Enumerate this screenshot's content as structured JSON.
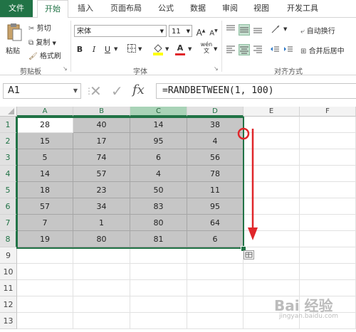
{
  "ribbon_tabs": [
    {
      "label": "文件"
    },
    {
      "label": "开始"
    },
    {
      "label": "插入"
    },
    {
      "label": "页面布局"
    },
    {
      "label": "公式"
    },
    {
      "label": "数据"
    },
    {
      "label": "审阅"
    },
    {
      "label": "视图"
    },
    {
      "label": "开发工具"
    }
  ],
  "clipboard": {
    "paste_label": "粘贴",
    "cut_label": "剪切",
    "copy_label": "复制",
    "format_painter_label": "格式刷",
    "group_label": "剪贴板"
  },
  "font": {
    "font_name": "宋体",
    "font_size": "11",
    "bold": "B",
    "italic": "I",
    "underline": "U",
    "grow": "A",
    "shrink": "A",
    "font_color_letter": "A",
    "group_label": "字体"
  },
  "alignment": {
    "wrap_text_label": "自动换行",
    "merge_center_label": "合并后居中",
    "group_label": "对齐方式"
  },
  "formula_bar": {
    "name_box": "A1",
    "fx": "fx",
    "formula": "=RANDBETWEEN(1, 100)"
  },
  "sheet": {
    "columns": [
      "A",
      "B",
      "C",
      "D",
      "E",
      "F"
    ],
    "rows": [
      "1",
      "2",
      "3",
      "4",
      "5",
      "6",
      "7",
      "8",
      "9",
      "10",
      "11",
      "12",
      "13"
    ],
    "values": [
      [
        "28",
        "40",
        "14",
        "38"
      ],
      [
        "15",
        "17",
        "95",
        "4"
      ],
      [
        "5",
        "74",
        "6",
        "56"
      ],
      [
        "14",
        "57",
        "4",
        "78"
      ],
      [
        "18",
        "23",
        "50",
        "11"
      ],
      [
        "57",
        "34",
        "83",
        "95"
      ],
      [
        "7",
        "1",
        "80",
        "64"
      ],
      [
        "19",
        "80",
        "81",
        "6"
      ]
    ]
  },
  "colors": {
    "excel_green": "#217346",
    "annotation_red": "#e0262a",
    "selection_gray": "#c6c6c6"
  },
  "watermark": "Bai 经验",
  "watermark_url": "jingyan.baidu.com"
}
